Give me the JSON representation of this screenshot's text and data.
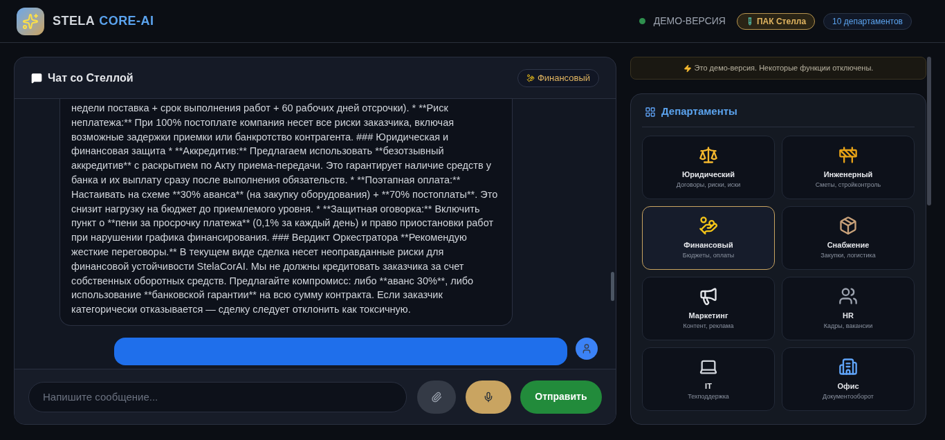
{
  "header": {
    "brand_primary": "STELA",
    "brand_accent": "CORE-AI",
    "status": {
      "label": "ДЕМО-ВЕРСИЯ",
      "online": true
    },
    "pack_button": "ПАК Стелла",
    "departments_count": "10 департаментов"
  },
  "chat": {
    "title": "Чат со Стеллой",
    "department_badge": "Финансовый",
    "messages": [
      {
        "kind": "assistant",
        "text": "недели поставка + срок выполнения работ + 60 рабочих дней отсрочки). * **Риск неплатежа:** При 100% постоплате компания несет все риски заказчика, включая возможные задержки приемки или банкротство контрагента. ### Юридическая и финансовая защита * **Аккредитив:** Предлагаем использовать **безотзывный аккредитив** с раскрытием по Акту приема-передачи. Это гарантирует наличие средств у банка и их выплату сразу после выполнения обязательств. * **Поэтапная оплата:** Настаивать на схеме **30% аванса** (на закупку оборудования) + **70% постоплаты**. Это снизит нагрузку на бюджет до приемлемого уровня. * **Защитная оговорка:** Включить пункт о **пени за просрочку платежа** (0,1% за каждый день) и право приостановки работ при нарушении графика финансирования. ### Вердикт Оркестратора **Рекомендую жесткие переговоры.** В текущем виде сделка несет неоправданные риски для финансовой устойчивости StelaCorAI. Мы не должны кредитовать заказчика за счет собственных оборотных средств. Предлагайте компромисс: либо **аванс 30%**, либо использование **банковской гарантии** на всю сумму контракта. Если заказчик категорически отказывается — сделку следует отклонить как токсичную."
      },
      {
        "kind": "user"
      }
    ],
    "input": {
      "placeholder": "Напишите сообщение..."
    },
    "send_button": "Отправить"
  },
  "demo_notice": "Это демо-версия. Некоторые функции отключены.",
  "departments": {
    "title": "Департаменты",
    "items": [
      {
        "name": "Юридический",
        "description": "Договоры, риски, иски",
        "selected": false
      },
      {
        "name": "Инженерный",
        "description": "Сметы, стройконтроль",
        "selected": false
      },
      {
        "name": "Финансовый",
        "description": "Бюджеты, оплаты",
        "selected": true
      },
      {
        "name": "Снабжение",
        "description": "Закупки, логистика",
        "selected": false
      },
      {
        "name": "Маркетинг",
        "description": "Контент, реклама",
        "selected": false
      },
      {
        "name": "HR",
        "description": "Кадры, вакансии",
        "selected": false
      },
      {
        "name": "IT",
        "description": "Техподдержка",
        "selected": false
      },
      {
        "name": "Офис",
        "description": "Документооборот",
        "selected": false
      }
    ]
  }
}
